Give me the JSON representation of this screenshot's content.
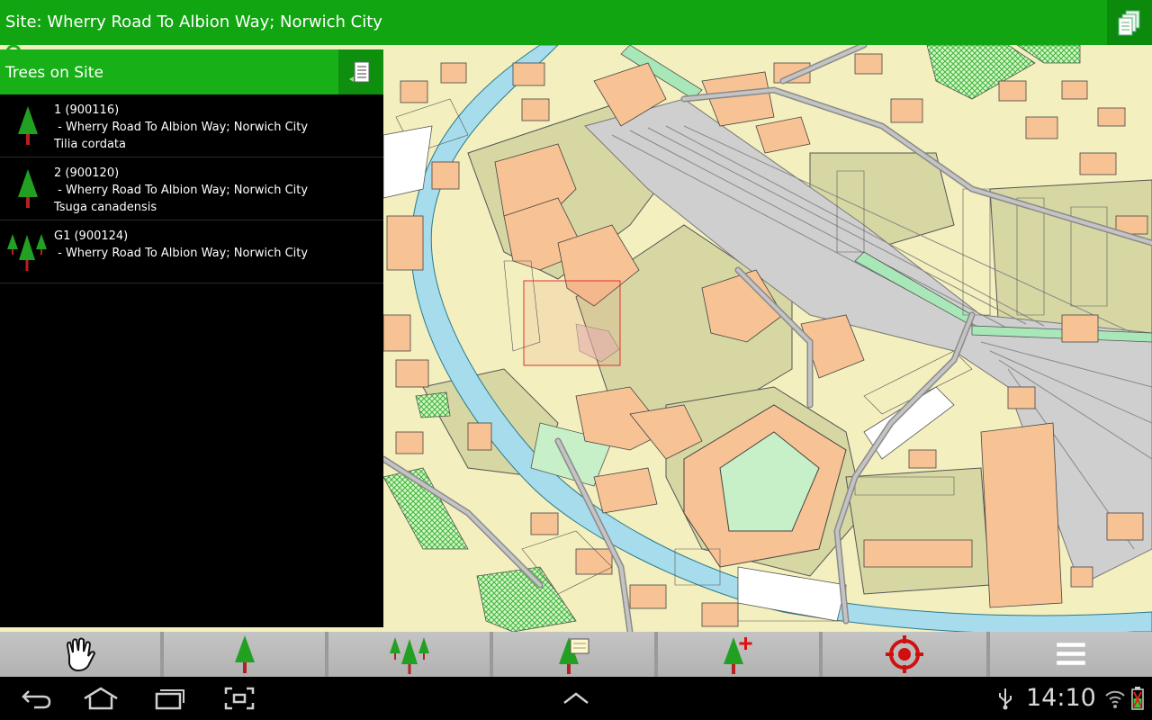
{
  "app": {
    "title": "Site: Wherry Road To Albion Way; Norwich City",
    "accent_color": "#11a611"
  },
  "side_panel": {
    "title": "Trees on Site",
    "items": [
      {
        "icon": "single-tree-icon",
        "id_line": "1 (900116)",
        "location": " - Wherry Road To Albion Way; Norwich City",
        "species": "Tilia cordata"
      },
      {
        "icon": "single-tree-icon",
        "id_line": "2 (900120)",
        "location": " - Wherry Road To Albion Way; Norwich City",
        "species": "Tsuga canadensis"
      },
      {
        "icon": "tree-group-icon",
        "id_line": "G1 (900124)",
        "location": " - Wherry Road To Albion Way; Norwich City",
        "species": ""
      }
    ]
  },
  "toolbar": {
    "tools": [
      {
        "name": "pan-tool",
        "icon": "hand-icon"
      },
      {
        "name": "add-tree-tool",
        "icon": "tree-icon"
      },
      {
        "name": "add-group-tool",
        "icon": "tree-group-icon"
      },
      {
        "name": "tree-note-tool",
        "icon": "tree-note-icon"
      },
      {
        "name": "new-tree-tool",
        "icon": "tree-add-icon"
      },
      {
        "name": "locate-tool",
        "icon": "crosshair-icon"
      },
      {
        "name": "menu-tool",
        "icon": "menu-icon"
      }
    ]
  },
  "system_bar": {
    "time": "14:10",
    "icons": [
      "back-icon",
      "home-icon",
      "recents-icon",
      "screenshot-icon",
      "up-chevron-icon",
      "usb-icon",
      "wifi-icon",
      "battery-icon"
    ]
  },
  "map": {
    "colors": {
      "land": "#f3efbe",
      "building": "#f7c394",
      "open_space": "#d7d7a4",
      "river": "#a6dcec",
      "rail": "#cfcfcf",
      "grass": "#a8e8b8",
      "selection": "#e03030"
    }
  }
}
